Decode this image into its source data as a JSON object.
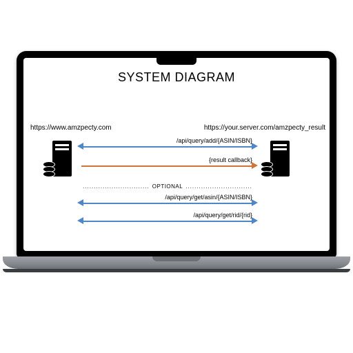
{
  "title": "SYSTEM DIAGRAM",
  "hosts": {
    "left": "https://www.amzpecty.com",
    "right": "https://your.server.com/amzpecty_result"
  },
  "arrows": {
    "r1_label": "/api/query/add/{ASIN/ISBN}",
    "r2_label": "{result callback}",
    "r3_label": "/api/query/get/asin/{ASIN/ISBN}",
    "r4_label": "/api/query/get/rid/{rid}"
  },
  "optional": {
    "dots_left": "..............................",
    "text": "OPTIONAL",
    "dots_right": ".............................."
  }
}
